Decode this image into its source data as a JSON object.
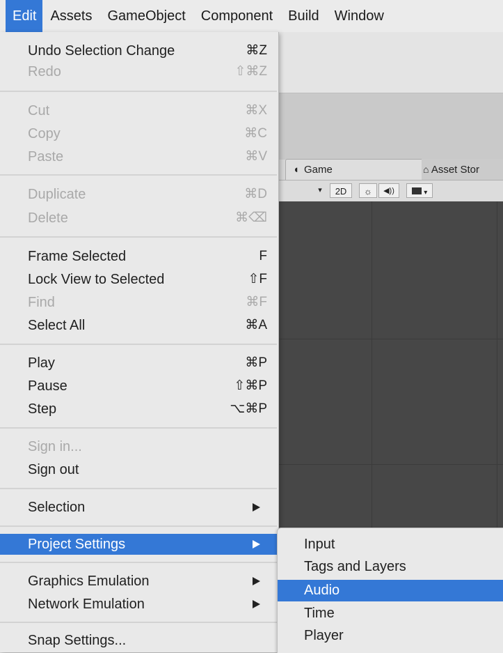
{
  "menubar": {
    "items": [
      "Edit",
      "Assets",
      "GameObject",
      "Component",
      "Build",
      "Window"
    ]
  },
  "edit_menu": {
    "undo": {
      "label": "Undo Selection Change",
      "shortcut": "⌘Z"
    },
    "redo": {
      "label": "Redo",
      "shortcut": "⇧⌘Z"
    },
    "cut": {
      "label": "Cut",
      "shortcut": "⌘X"
    },
    "copy": {
      "label": "Copy",
      "shortcut": "⌘C"
    },
    "paste": {
      "label": "Paste",
      "shortcut": "⌘V"
    },
    "duplicate": {
      "label": "Duplicate",
      "shortcut": "⌘D"
    },
    "delete": {
      "label": "Delete",
      "shortcut": "⌘⌫"
    },
    "frame_selected": {
      "label": "Frame Selected",
      "shortcut": "F"
    },
    "lock_view": {
      "label": "Lock View to Selected",
      "shortcut": "⇧F"
    },
    "find": {
      "label": "Find",
      "shortcut": "⌘F"
    },
    "select_all": {
      "label": "Select All",
      "shortcut": "⌘A"
    },
    "play": {
      "label": "Play",
      "shortcut": "⌘P"
    },
    "pause": {
      "label": "Pause",
      "shortcut": "⇧⌘P"
    },
    "step": {
      "label": "Step",
      "shortcut": "⌥⌘P"
    },
    "sign_in": {
      "label": "Sign in..."
    },
    "sign_out": {
      "label": "Sign out"
    },
    "selection": {
      "label": "Selection"
    },
    "project_settings": {
      "label": "Project Settings"
    },
    "graphics_emulation": {
      "label": "Graphics Emulation"
    },
    "network_emulation": {
      "label": "Network Emulation"
    },
    "snap_settings": {
      "label": "Snap Settings..."
    }
  },
  "submenu": {
    "items": [
      "Input",
      "Tags and Layers",
      "Audio",
      "Time",
      "Player"
    ],
    "highlighted": "Audio"
  },
  "background": {
    "game_tab": "Game",
    "asset_store_tab": "Asset Stor",
    "btn_2d": "2D",
    "sun_glyph": "☼",
    "audio_glyph": "◀))",
    "dropdown_glyph": "▾"
  },
  "colors": {
    "highlight": "#3478d6",
    "menu_bg": "#e9e9e9",
    "scene_bg": "#474747"
  }
}
